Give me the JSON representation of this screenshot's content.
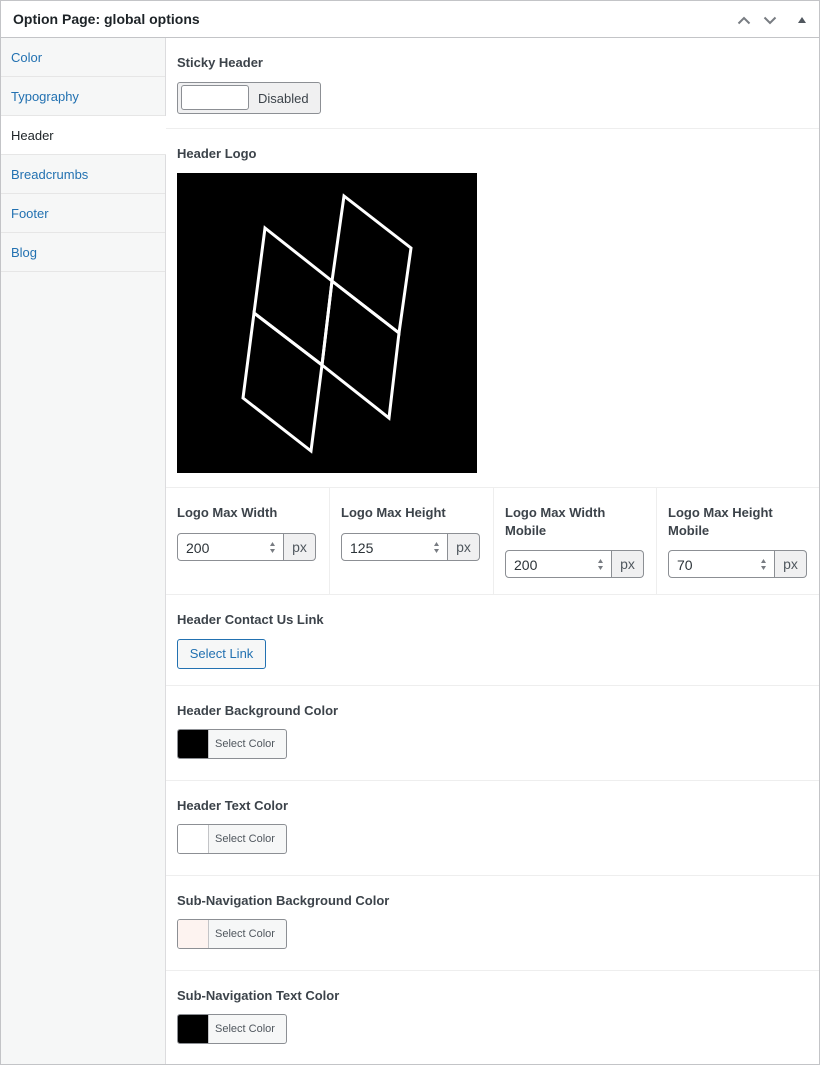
{
  "panel": {
    "title": "Option Page: global options",
    "controls": {
      "move_up_icon": "chevron-up-icon",
      "move_down_icon": "chevron-down-icon",
      "toggle_icon": "triangle-up-icon"
    }
  },
  "sidebar": {
    "items": [
      {
        "label": "Color",
        "active": false
      },
      {
        "label": "Typography",
        "active": false
      },
      {
        "label": "Header",
        "active": true
      },
      {
        "label": "Breadcrumbs",
        "active": false
      },
      {
        "label": "Footer",
        "active": false
      },
      {
        "label": "Blog",
        "active": false
      }
    ]
  },
  "fields": {
    "sticky_header": {
      "label": "Sticky Header",
      "toggle_state": "Disabled"
    },
    "header_logo": {
      "label": "Header Logo",
      "image": "white geometric outline logo on black background"
    },
    "logo_dimensions": [
      {
        "label": "Logo Max Width",
        "value": "200",
        "unit": "px"
      },
      {
        "label": "Logo Max Height",
        "value": "125",
        "unit": "px"
      },
      {
        "label": "Logo Max Width Mobile",
        "value": "200",
        "unit": "px"
      },
      {
        "label": "Logo Max Height Mobile",
        "value": "70",
        "unit": "px"
      }
    ],
    "contact_link": {
      "label": "Header Contact Us Link",
      "button": "Select Link"
    },
    "colors": [
      {
        "label": "Header Background Color",
        "button": "Select Color",
        "swatch": "#000000"
      },
      {
        "label": "Header Text Color",
        "button": "Select Color",
        "swatch": "#ffffff"
      },
      {
        "label": "Sub-Navigation Background Color",
        "button": "Select Color",
        "swatch": "#fdf3f0"
      },
      {
        "label": "Sub-Navigation Text Color",
        "button": "Select Color",
        "swatch": "#000000"
      }
    ]
  },
  "colors": {
    "link": "#2271b1",
    "border": "#c3c4c7",
    "sidebar_bg": "#f6f7f7"
  }
}
